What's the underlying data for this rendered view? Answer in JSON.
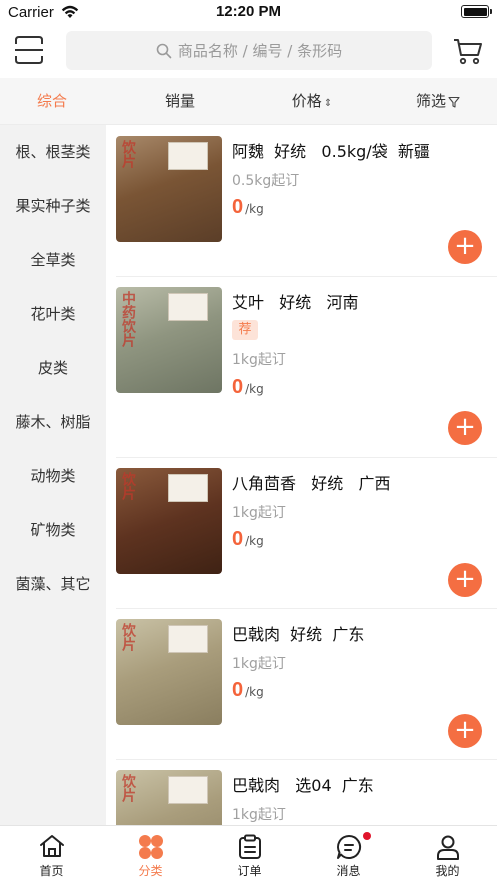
{
  "status": {
    "carrier": "Carrier",
    "time": "12:20 PM"
  },
  "search": {
    "placeholder": "商品名称 / 编号 / 条形码"
  },
  "sort_tabs": [
    {
      "label": "综合",
      "active": true
    },
    {
      "label": "销量",
      "active": false
    },
    {
      "label": "价格",
      "active": false
    },
    {
      "label": "筛选",
      "active": false
    }
  ],
  "categories": [
    "根、根茎类",
    "果实种子类",
    "全草类",
    "花叶类",
    "皮类",
    "藤木、树脂",
    "动物类",
    "矿物类",
    "菌藻、其它"
  ],
  "products": [
    {
      "name": "阿魏  好统   0.5kg/袋  新疆",
      "tag": "",
      "moq": "0.5kg起订",
      "price": "0",
      "unit": "/kg",
      "stamp": "饮片"
    },
    {
      "name": "艾叶   好统   河南",
      "tag": "荐",
      "moq": "1kg起订",
      "price": "0",
      "unit": "/kg",
      "stamp": "中药饮片"
    },
    {
      "name": "八角茴香   好统   广西",
      "tag": "",
      "moq": "1kg起订",
      "price": "0",
      "unit": "/kg",
      "stamp": "饮片"
    },
    {
      "name": "巴戟肉  好统  广东",
      "tag": "",
      "moq": "1kg起订",
      "price": "0",
      "unit": "/kg",
      "stamp": "饮片"
    },
    {
      "name": "巴戟肉   选04  广东",
      "tag": "",
      "moq": "1kg起订",
      "price": "",
      "unit": "",
      "stamp": "饮片"
    }
  ],
  "tabbar": [
    {
      "label": "首页",
      "icon": "home-icon",
      "active": false
    },
    {
      "label": "分类",
      "icon": "category-icon",
      "active": true
    },
    {
      "label": "订单",
      "icon": "order-icon",
      "active": false
    },
    {
      "label": "消息",
      "icon": "message-icon",
      "active": false,
      "badge": true
    },
    {
      "label": "我的",
      "icon": "profile-icon",
      "active": false
    }
  ],
  "colors": {
    "accent": "#f47b4d",
    "price": "#f4633a",
    "add_button": "#f46e42",
    "badge": "#e0142b"
  }
}
